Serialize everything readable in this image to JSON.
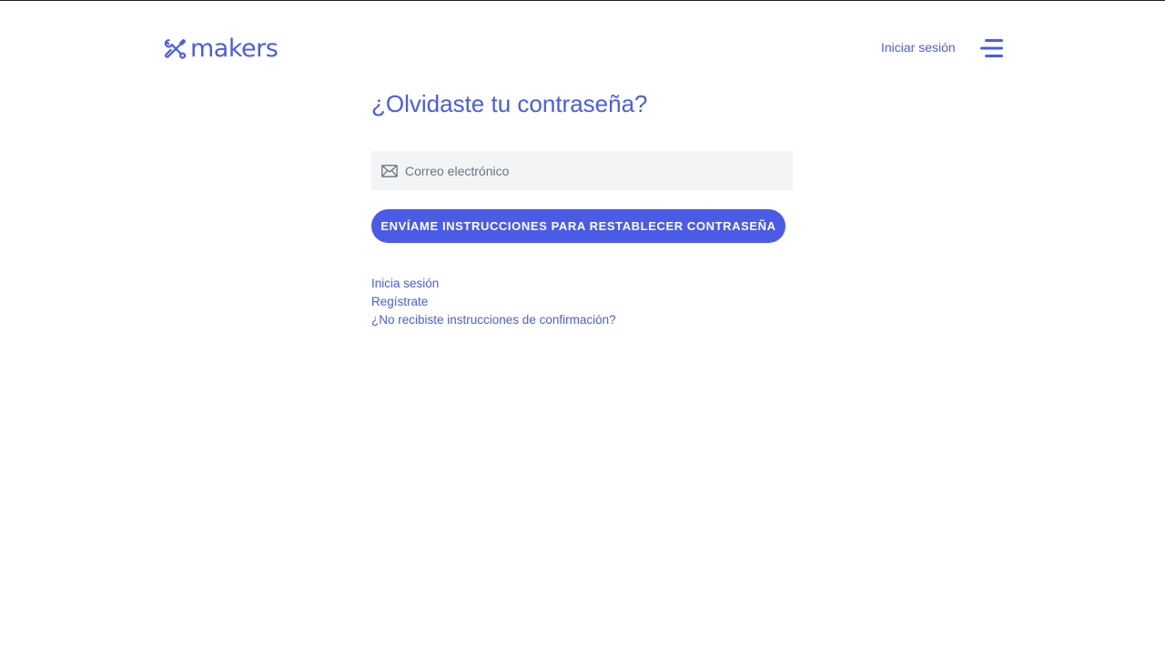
{
  "header": {
    "logo_text": "makers",
    "login_label": "Iniciar sesión",
    "menu_icon": "hamburger-menu-icon",
    "logo_icon": "wrench-screwdriver-icon"
  },
  "main": {
    "title": "¿Olvidaste tu contraseña?",
    "email": {
      "icon": "envelope-icon",
      "placeholder": "Correo electrónico",
      "value": ""
    },
    "submit_label": "ENVÍAME INSTRUCCIONES PARA RESTABLECER CONTRASEÑA",
    "links": [
      {
        "label": "Inicia sesión"
      },
      {
        "label": "Regístrate"
      },
      {
        "label": "¿No recibiste instrucciones de confirmación?"
      }
    ]
  },
  "colors": {
    "accent": "#4a5ce6",
    "input_bg": "#f3f4f6",
    "background": "#ffffff"
  }
}
